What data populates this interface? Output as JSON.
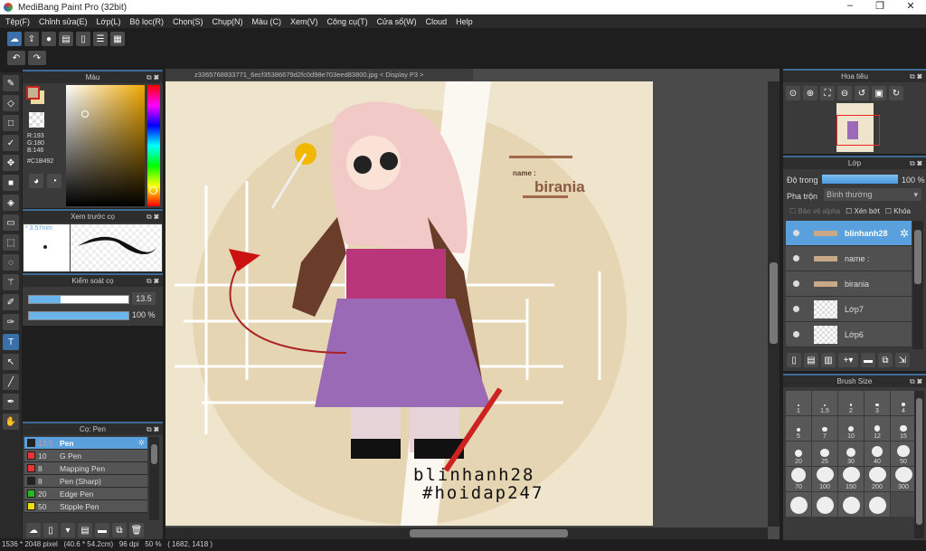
{
  "app": {
    "title": "MediBang Paint Pro (32bit)"
  },
  "menu": [
    "Tệp(F)",
    "Chỉnh sửa(E)",
    "Lớp(L)",
    "Bộ lọc(R)",
    "Chọn(S)",
    "Chụp(N)",
    "Màu (C)",
    "Xem(V)",
    "Công cụ(T)",
    "Cửa sổ(W)",
    "Cloud",
    "Help"
  ],
  "document": {
    "tab": "z3365768833771_6ecf35386679d2fc0d98e703eed83800.jpg < Display P3 >",
    "art": {
      "name_label": "name :",
      "name_value": "birania",
      "sig1": "blinhanh28",
      "sig2": "#hoidap247"
    }
  },
  "color_panel": {
    "title": "Màu",
    "r": "R:193",
    "g": "G:180",
    "b": "B:146",
    "hex": "#C1B492",
    "fg": "#C1B492",
    "bg": "#F0DCA0"
  },
  "brush_preview": {
    "title": "Xem trước cọ",
    "size": "* 3.57mm"
  },
  "brush_control": {
    "title": "Kiểm soát cọ",
    "size_value": "13.5",
    "size_fraction": 0.32,
    "opacity": "100 %",
    "opacity_fraction": 1.0
  },
  "brush_list": {
    "title": "Cọ: Pen",
    "items": [
      {
        "size": "13.5",
        "name": "Pen",
        "color": "#222222",
        "selected": true
      },
      {
        "size": "10",
        "name": "G Pen",
        "color": "#ee3333"
      },
      {
        "size": "8",
        "name": "Mapping Pen",
        "color": "#ee3333"
      },
      {
        "size": "8",
        "name": "Pen (Sharp)",
        "color": "#222222"
      },
      {
        "size": "20",
        "name": "Edge Pen",
        "color": "#22bb22"
      },
      {
        "size": "50",
        "name": "Stipple Pen",
        "color": "#eedd11"
      }
    ]
  },
  "navigator": {
    "title": "Hoa tiêu"
  },
  "layers": {
    "title": "Lớp",
    "opacity_label": "Độ trong",
    "opacity": "100 %",
    "blend_label": "Pha trộn",
    "blend": "Bình thường",
    "protect_alpha": "Bảo vệ alpha",
    "clip": "Xén bớt",
    "lock": "Khóa",
    "items": [
      {
        "name": "blinhanh28",
        "selected": true
      },
      {
        "name": "name :"
      },
      {
        "name": "birania"
      },
      {
        "name": "Lớp7"
      },
      {
        "name": "Lớp6"
      }
    ]
  },
  "brush_size": {
    "title": "Brush Size",
    "sizes": [
      "1",
      "1.5",
      "2",
      "3",
      "4",
      "5",
      "7",
      "10",
      "12",
      "15",
      "20",
      "25",
      "30",
      "40",
      "50",
      "70",
      "100",
      "150",
      "200",
      "300",
      "",
      "",
      "",
      ""
    ]
  },
  "status": "1536 * 2048 pixel   (40.6 * 54.2cm)   96 dpi   50 %   ( 1682, 1418 )"
}
